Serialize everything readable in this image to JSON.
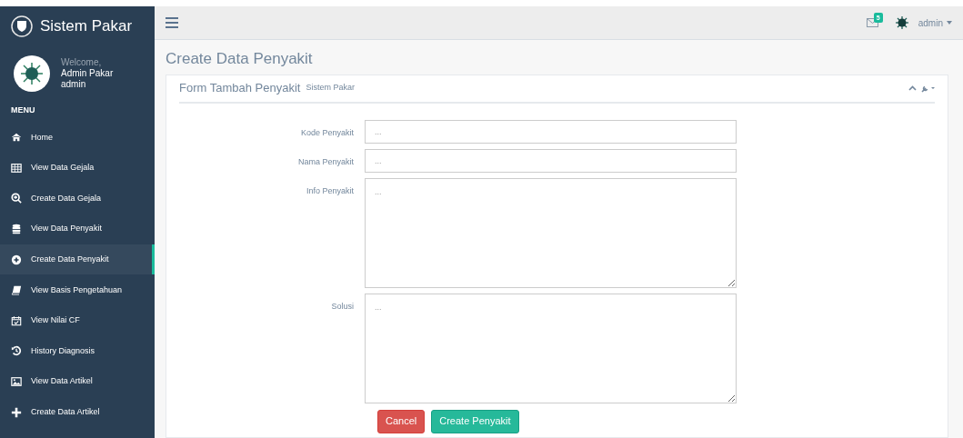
{
  "sidebar": {
    "brand": "Sistem Pakar",
    "welcome": "Welcome,",
    "user_name": "Admin Pakar",
    "user_role": "admin",
    "menu_heading": "MENU",
    "items": [
      {
        "label": "Home",
        "selected": false
      },
      {
        "label": "View Data Gejala",
        "selected": false
      },
      {
        "label": "Create Data Gejala",
        "selected": false
      },
      {
        "label": "View Data Penyakit",
        "selected": false
      },
      {
        "label": "Create Data Penyakit",
        "selected": true
      },
      {
        "label": "View Basis Pengetahuan",
        "selected": false
      },
      {
        "label": "View Nilai CF",
        "selected": false
      },
      {
        "label": "History Diagnosis",
        "selected": false
      },
      {
        "label": "View Data Artikel",
        "selected": false
      },
      {
        "label": "Create Data Artikel",
        "selected": false
      }
    ]
  },
  "top_nav": {
    "message_count": "5",
    "user": "admin"
  },
  "page_title": "Create Data Penyakit",
  "panel": {
    "title": "Form Tambah Penyakit",
    "subtitle": "Sistem Pakar",
    "fields": [
      {
        "label": "Kode Penyakit",
        "placeholder": "...",
        "kind": "input"
      },
      {
        "label": "Nama Penyakit",
        "placeholder": "...",
        "kind": "input"
      },
      {
        "label": "Info Penyakit",
        "placeholder": "...",
        "kind": "textarea"
      },
      {
        "label": "Solusi",
        "placeholder": "...",
        "kind": "textarea"
      }
    ],
    "buttons": [
      {
        "label": "Cancel",
        "kind": "danger"
      },
      {
        "label": "Create Penyakit",
        "kind": "success"
      }
    ]
  }
}
